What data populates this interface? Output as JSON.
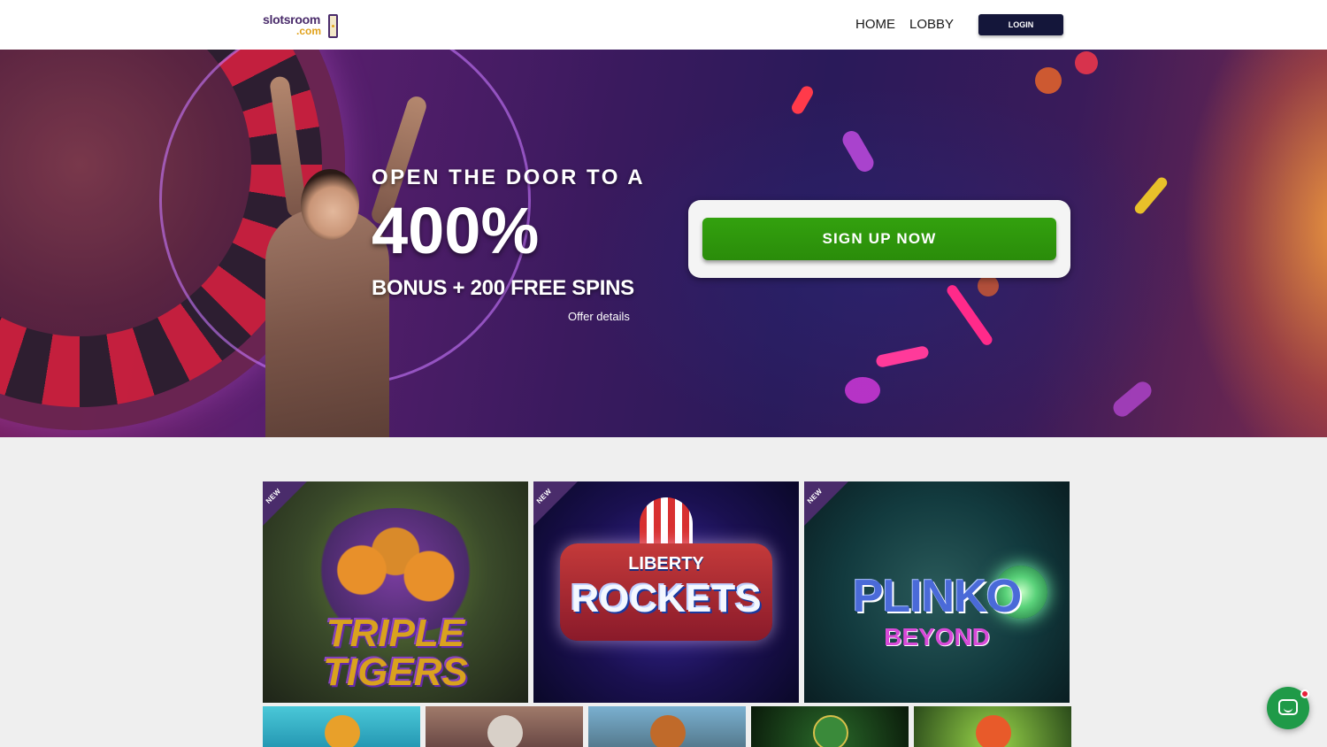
{
  "header": {
    "logo_top": "slotsroom",
    "logo_bottom": ".com",
    "nav": [
      "HOME",
      "LOBBY"
    ],
    "login_label": "LOGIN"
  },
  "hero": {
    "line1": "OPEN THE DOOR TO A",
    "big": "400%",
    "line3": "BONUS + 200 FREE SPINS",
    "offer_link": "Offer details",
    "cta_label": "SIGN UP NOW"
  },
  "games": {
    "featured": [
      {
        "badge": "NEW",
        "title_top": "TRIPLE",
        "title_bottom": "TIGERS"
      },
      {
        "badge": "NEW",
        "title_top": "LIBERTY",
        "title_bottom": "ROCKETS"
      },
      {
        "badge": "NEW",
        "title_top": "PLINKO",
        "title_bottom": "BEYOND"
      }
    ]
  },
  "colors": {
    "brand_purple": "#4a2c6b",
    "brand_gold": "#e0a11b",
    "login_bg": "#14163a",
    "cta_green": "#2a8c0a",
    "chat_green": "#1f9a48"
  },
  "icons": {
    "chat": "chat-bubble-icon",
    "logo": "door-icon"
  }
}
